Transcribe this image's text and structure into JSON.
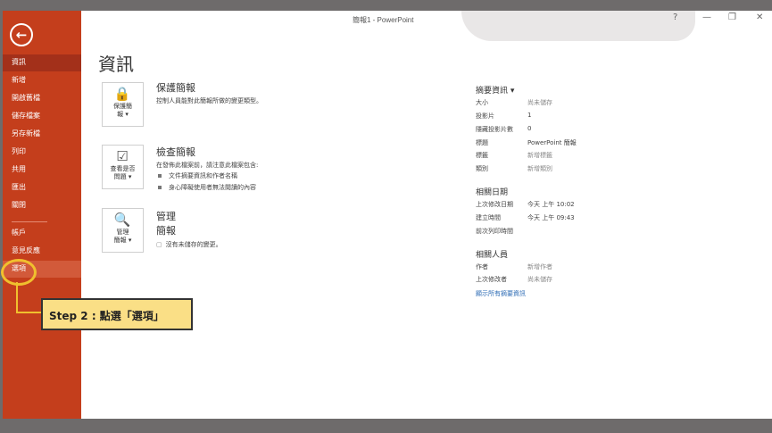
{
  "window": {
    "title": "簡報1 - PowerPoint",
    "help_label": "?",
    "minimize_label": "—",
    "restore_label": "❐",
    "close_label": "✕"
  },
  "sidebar": {
    "back_icon": "←",
    "items": [
      {
        "label": "資訊"
      },
      {
        "label": "新增"
      },
      {
        "label": "開啟舊檔"
      },
      {
        "label": "儲存檔案"
      },
      {
        "label": "另存新檔"
      },
      {
        "label": "列印"
      },
      {
        "label": "共用"
      },
      {
        "label": "匯出"
      },
      {
        "label": "關閉"
      },
      {
        "label": "帳戶"
      },
      {
        "label": "意見反應"
      },
      {
        "label": "選項"
      }
    ]
  },
  "main": {
    "heading": "資訊",
    "protect": {
      "button_line1": "保護簡",
      "button_line2": "報 ▾",
      "title": "保護簡報",
      "desc": "控制人員能對此簡報所做的變更類型。"
    },
    "inspect": {
      "button_line1": "查看是否",
      "button_line2": "問題 ▾",
      "title": "檢查簡報",
      "desc": "在發佈此檔案前，請注意此檔案包含:",
      "bullets": [
        "文件摘要資訊和作者名稱",
        "身心障礙使用者無法閱讀的內容"
      ]
    },
    "manage": {
      "button_line1": "管理",
      "button_line2": "簡報 ▾",
      "title_line1": "管理",
      "title_line2": "簡報",
      "desc": "沒有未儲存的變更。"
    }
  },
  "properties": {
    "header": "摘要資訊 ▾",
    "rows": [
      {
        "key": "大小",
        "value": "尚未儲存"
      },
      {
        "key": "投影片",
        "value": "1"
      },
      {
        "key": "隱藏投影片數",
        "value": "0"
      },
      {
        "key": "標題",
        "value": "PowerPoint 簡報"
      },
      {
        "key": "標籤",
        "value": "新增標籤"
      },
      {
        "key": "類別",
        "value": "新增類別"
      }
    ],
    "dates_header": "相關日期",
    "dates": [
      {
        "key": "上次修改日期",
        "value": "今天 上午 10:02"
      },
      {
        "key": "建立時間",
        "value": "今天 上午 09:43"
      },
      {
        "key": "前次列印時間",
        "value": ""
      }
    ],
    "people_header": "相關人員",
    "people": [
      {
        "key": "作者",
        "value": "新增作者"
      },
      {
        "key": "上次修改者",
        "value": "尚未儲存"
      }
    ],
    "show_all": "顯示所有摘要資訊"
  },
  "annotation": {
    "text": "Step 2 : 點選「選項」"
  }
}
